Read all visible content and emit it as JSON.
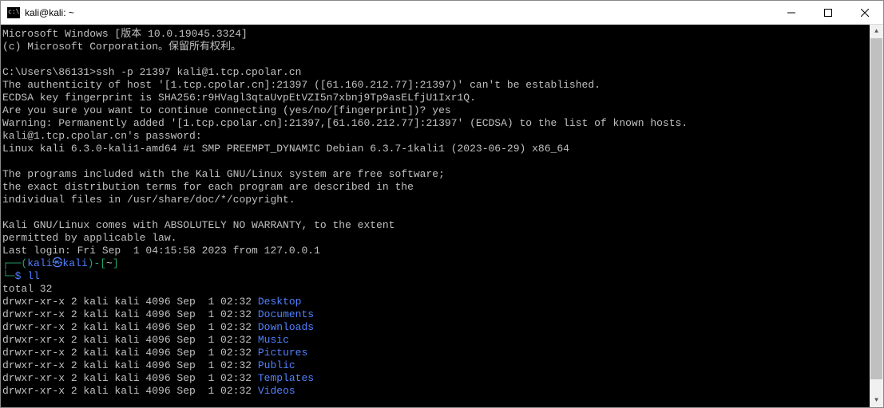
{
  "titlebar": {
    "title": "kali@kali: ~"
  },
  "term": {
    "line1": "Microsoft Windows [版本 10.0.19045.3324]",
    "line2": "(c) Microsoft Corporation。保留所有权利。",
    "blank1": "",
    "line3": "C:\\Users\\86131>ssh -p 21397 kali@1.tcp.cpolar.cn",
    "line4": "The authenticity of host '[1.tcp.cpolar.cn]:21397 ([61.160.212.77]:21397)' can't be established.",
    "line5": "ECDSA key fingerprint is SHA256:r9HVagl3qtaUvpEtVZI5n7xbnj9Tp9asELfjU1Ixr1Q.",
    "line6": "Are you sure you want to continue connecting (yes/no/[fingerprint])? yes",
    "line7": "Warning: Permanently added '[1.tcp.cpolar.cn]:21397,[61.160.212.77]:21397' (ECDSA) to the list of known hosts.",
    "line8": "kali@1.tcp.cpolar.cn's password:",
    "line9": "Linux kali 6.3.0-kali1-amd64 #1 SMP PREEMPT_DYNAMIC Debian 6.3.7-1kali1 (2023-06-29) x86_64",
    "blank2": "",
    "line10": "The programs included with the Kali GNU/Linux system are free software;",
    "line11": "the exact distribution terms for each program are described in the",
    "line12": "individual files in /usr/share/doc/*/copyright.",
    "blank3": "",
    "line13": "Kali GNU/Linux comes with ABSOLUTELY NO WARRANTY, to the extent",
    "line14": "permitted by applicable law.",
    "line15": "Last login: Fri Sep  1 04:15:58 2023 from 127.0.0.1",
    "prompt": {
      "p1": "┌──(",
      "p2": "kali㉿kali",
      "p3": ")-[",
      "p4": "~",
      "p5": "]",
      "p6": "└─",
      "p7": "$ ",
      "cmd": "ll"
    },
    "total": "total 32",
    "ls": [
      {
        "perm": "drwxr-xr-x 2 kali kali 4096 Sep  1 02:32 ",
        "name": "Desktop"
      },
      {
        "perm": "drwxr-xr-x 2 kali kali 4096 Sep  1 02:32 ",
        "name": "Documents"
      },
      {
        "perm": "drwxr-xr-x 2 kali kali 4096 Sep  1 02:32 ",
        "name": "Downloads"
      },
      {
        "perm": "drwxr-xr-x 2 kali kali 4096 Sep  1 02:32 ",
        "name": "Music"
      },
      {
        "perm": "drwxr-xr-x 2 kali kali 4096 Sep  1 02:32 ",
        "name": "Pictures"
      },
      {
        "perm": "drwxr-xr-x 2 kali kali 4096 Sep  1 02:32 ",
        "name": "Public"
      },
      {
        "perm": "drwxr-xr-x 2 kali kali 4096 Sep  1 02:32 ",
        "name": "Templates"
      },
      {
        "perm": "drwxr-xr-x 2 kali kali 4096 Sep  1 02:32 ",
        "name": "Videos"
      }
    ]
  }
}
